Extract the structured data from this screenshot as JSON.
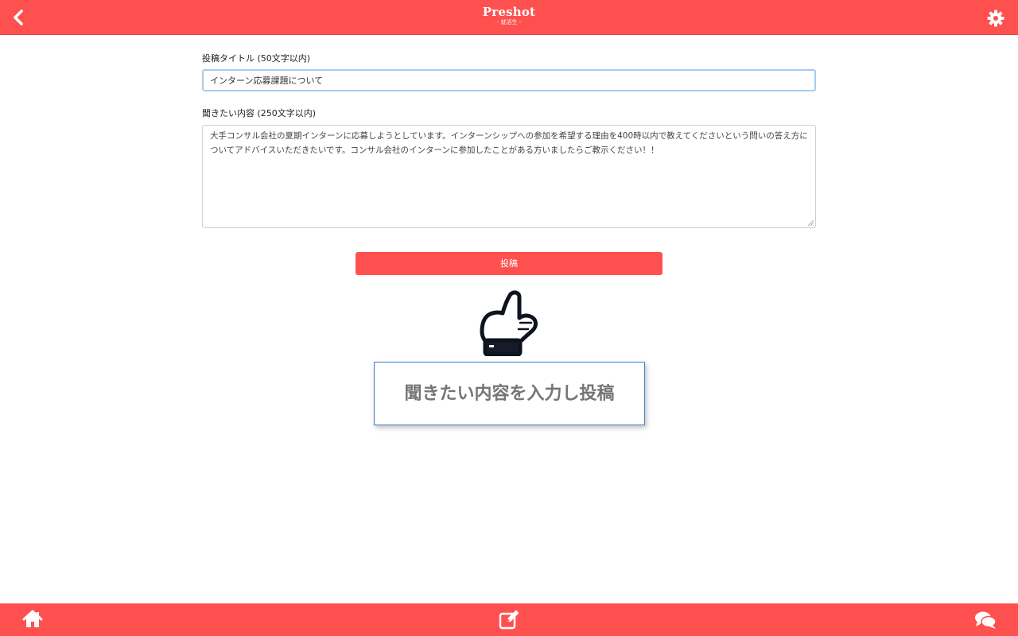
{
  "header": {
    "logo_main": "Preshot",
    "logo_sub": "- 就活生 -",
    "back_icon": "chevron-left-icon",
    "settings_icon": "gear-icon"
  },
  "form": {
    "title_label": "投稿タイトル (50文字以内)",
    "title_value": "インターン応募課題について",
    "content_label": "聞きたい内容 (250文字以内)",
    "content_value": "大手コンサル会社の夏期インターンに応募しようとしています。インターンシップへの参加を希望する理由を400時以内で教えてくださいという問いの答え方についてアドバイスいただきたいです。コンサル会社のインターンに参加したことがある方いましたらご教示ください！！",
    "submit_label": "投稿"
  },
  "tutorial": {
    "hand_icon": "pointing-hand-icon",
    "tooltip_text": "聞きたい内容を入力し投稿"
  },
  "bottom_nav": {
    "home_icon": "home-icon",
    "post_icon": "edit-icon",
    "chat_icon": "chat-icon"
  },
  "colors": {
    "accent": "#ff5050",
    "tooltip_border": "#3d7fd0",
    "input_focus_border": "#a8cbef"
  }
}
